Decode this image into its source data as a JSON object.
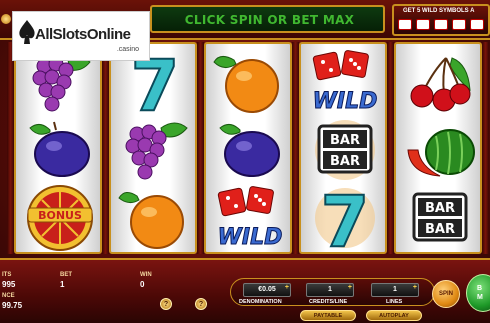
{
  "header": {
    "logo_text": "AllSlotsOnline",
    "logo_sub": ".casino",
    "message": "CLICK SPIN OR BET MAX",
    "bonus_message": "GET 5 WILD SYMBOLS A"
  },
  "reels": [
    [
      "grapes",
      "plum",
      "bonus-wheel"
    ],
    [
      "seven",
      "grapes",
      "orange"
    ],
    [
      "orange",
      "plum",
      "dice-wild"
    ],
    [
      "dice-wild",
      "bar-bar",
      "seven"
    ],
    [
      "cherries",
      "watermelon",
      "bar-bar"
    ]
  ],
  "symbols": {
    "wild_label": "WILD",
    "bar_label": "BAR",
    "bonus_label": "BONUS",
    "seven_label": "7"
  },
  "bottom": {
    "credits_label": "ITS",
    "credits_value": "995",
    "balance_label": "NCE",
    "balance_value": "99.75",
    "bet_label": "BET",
    "bet_value": "1",
    "win_label": "WIN",
    "win_value": "0",
    "denomination_value": "€0.05",
    "denomination_label": "DENOMINATION",
    "credits_line_value": "1",
    "credits_line_label": "CREDITS/LINE",
    "lines_value": "1",
    "lines_label": "LINES",
    "paytable_label": "PAYTABLE",
    "autoplay_label": "AUTOPLAY",
    "spin_label": "SPIN",
    "maxbet_label": "B\nM",
    "help_label": "?",
    "settings_label": "?"
  },
  "colors": {
    "gold": "#c8901e",
    "message_green": "#40b830",
    "maxbet_green": "#1e9a28",
    "spin_orange": "#e08a14"
  }
}
